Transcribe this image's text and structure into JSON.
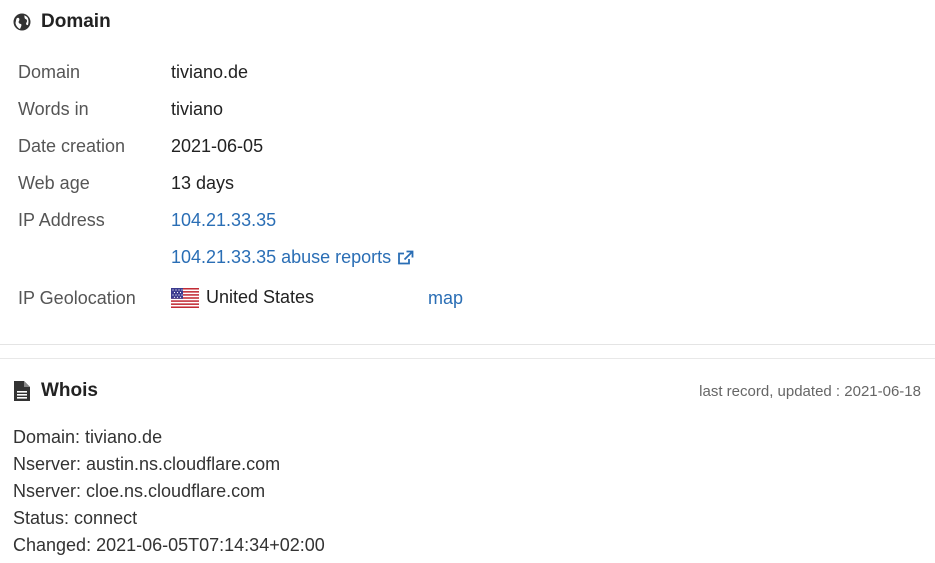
{
  "domain_section": {
    "title": "Domain",
    "icon": "globe-icon",
    "rows": [
      {
        "label": "Domain",
        "value": "tiviano.de"
      },
      {
        "label": "Words in",
        "value": "tiviano"
      },
      {
        "label": "Date creation",
        "value": "2021-06-05"
      },
      {
        "label": "Web age",
        "value": "13 days"
      },
      {
        "label": "IP Address",
        "value": "104.21.33.35"
      }
    ],
    "abuse_link": "104.21.33.35 abuse reports",
    "geolocation": {
      "label": "IP Geolocation",
      "country": "United States",
      "map_link": "map"
    }
  },
  "whois_section": {
    "title": "Whois",
    "icon": "document-icon",
    "updated": "last record, updated : 2021-06-18",
    "lines": [
      "Domain: tiviano.de",
      "Nserver: austin.ns.cloudflare.com",
      "Nserver: cloe.ns.cloudflare.com",
      "Status: connect",
      "Changed: 2021-06-05T07:14:34+02:00"
    ]
  },
  "colors": {
    "link": "#2a6eb5",
    "label": "#555555",
    "text": "#222222"
  }
}
